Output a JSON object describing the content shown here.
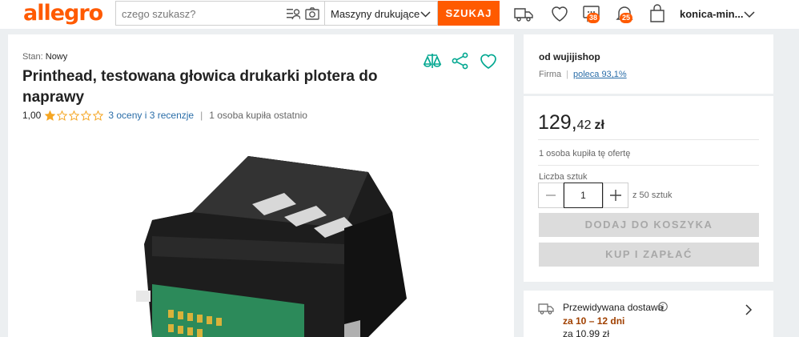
{
  "header": {
    "logo": "allegro",
    "search_placeholder": "czego szukasz?",
    "category": "Maszyny drukujące",
    "search_button": "SZUKAJ",
    "messages_badge": "38",
    "notifications_badge": "25",
    "user_name": "konica-min..."
  },
  "product": {
    "condition_label": "Stan:",
    "condition_value": "Nowy",
    "title": "Printhead, testowana głowica drukarki plotera do naprawy",
    "rating": "1,00",
    "stars_filled": 1,
    "stars_total": 5,
    "reviews": "3 oceny i 3 recenzje",
    "bought_recently": "1 osoba kupiła ostatnio"
  },
  "seller": {
    "prefix": "od wujijishop",
    "type": "Firma",
    "recommend": "poleca 93,1%"
  },
  "offer": {
    "price_int": "129,",
    "price_dec": "42",
    "currency": "zł",
    "bought_offer": "1 osoba kupiła tę ofertę",
    "qty_label": "Liczba sztuk",
    "qty_value": "1",
    "qty_of": "z 50 sztuk",
    "add_to_cart": "DODAJ DO KOSZYKA",
    "buy_now": "KUP I ZAPŁAĆ"
  },
  "delivery": {
    "label": "Przewidywana dostawa",
    "when": "za 10 – 12 dni",
    "cost": "za 10,99 zł"
  },
  "colors": {
    "brand": "#ff5a00",
    "teal_icons": "#00a790",
    "link": "#2a6da8",
    "star": "#f5a623"
  }
}
